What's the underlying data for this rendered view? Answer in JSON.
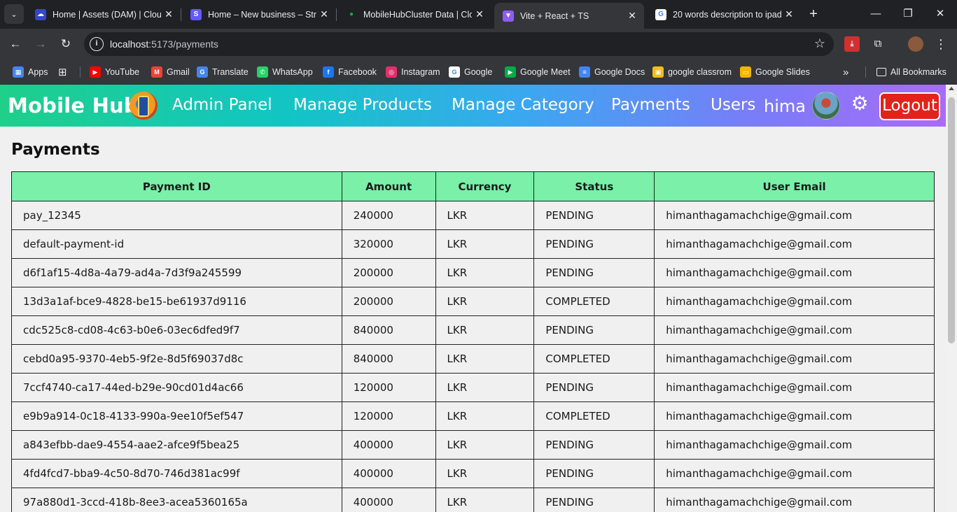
{
  "browser": {
    "tabs": [
      {
        "title": "Home | Assets (DAM) | Cloudinary",
        "favicon_color": "#3448c5",
        "favicon_glyph": "☁"
      },
      {
        "title": "Home – New business – Stripe",
        "favicon_color": "#635bff",
        "favicon_glyph": "S"
      },
      {
        "title": "MobileHubCluster Data | Cloud",
        "favicon_color": "#202124",
        "favicon_glyph": "●"
      },
      {
        "title": "Vite + React + TS",
        "favicon_color": "#8f5cf6",
        "favicon_glyph": "▼"
      },
      {
        "title": "20 words description to ipad",
        "favicon_color": "#ffffff",
        "favicon_glyph": "G"
      }
    ],
    "active_tab_index": 3,
    "url_host": "localhost",
    "url_path": ":5173/payments",
    "bookmarks": [
      {
        "label": "Apps",
        "icon": "apps-grid-icon",
        "color": "#4285f4"
      },
      {
        "label": "YouTube",
        "icon": "youtube-icon",
        "color": "#ff0000"
      },
      {
        "label": "Gmail",
        "icon": "gmail-icon",
        "color": "#ea4335"
      },
      {
        "label": "Translate",
        "icon": "translate-icon",
        "color": "#4285f4"
      },
      {
        "label": "WhatsApp",
        "icon": "whatsapp-icon",
        "color": "#25d366"
      },
      {
        "label": "Facebook",
        "icon": "facebook-icon",
        "color": "#1877f2"
      },
      {
        "label": "Instagram",
        "icon": "instagram-icon",
        "color": "#e1306c"
      },
      {
        "label": "Google",
        "icon": "google-icon",
        "color": "#ffffff"
      },
      {
        "label": "Google Meet",
        "icon": "google-meet-icon",
        "color": "#00ac47"
      },
      {
        "label": "Google Docs",
        "icon": "google-docs-icon",
        "color": "#4285f4"
      },
      {
        "label": "google classrom",
        "icon": "google-classroom-icon",
        "color": "#f6bb18"
      },
      {
        "label": "Google Slides",
        "icon": "google-slides-icon",
        "color": "#f4b400"
      }
    ],
    "all_bookmarks_label": "All Bookmarks"
  },
  "navbar": {
    "brand": "Mobile Hub",
    "links": [
      "Admin Panel",
      "Manage Products",
      "Manage Category",
      "Payments",
      "Users"
    ],
    "username": "hima",
    "logout_label": "Logout",
    "accent_gradient": [
      "#1fcf8a",
      "#a86cf6"
    ],
    "logout_color": "#e2231a"
  },
  "main": {
    "title": "Payments",
    "columns": [
      "Payment ID",
      "Amount",
      "Currency",
      "Status",
      "User Email"
    ],
    "header_color": "#7af0a8",
    "rows": [
      [
        "pay_12345",
        "240000",
        "LKR",
        "PENDING",
        "himanthagamachchige@gmail.com"
      ],
      [
        "default-payment-id",
        "320000",
        "LKR",
        "PENDING",
        "himanthagamachchige@gmail.com"
      ],
      [
        "d6f1af15-4d8a-4a79-ad4a-7d3f9a245599",
        "200000",
        "LKR",
        "PENDING",
        "himanthagamachchige@gmail.com"
      ],
      [
        "13d3a1af-bce9-4828-be15-be61937d9116",
        "200000",
        "LKR",
        "COMPLETED",
        "himanthagamachchige@gmail.com"
      ],
      [
        "cdc525c8-cd08-4c63-b0e6-03ec6dfed9f7",
        "840000",
        "LKR",
        "PENDING",
        "himanthagamachchige@gmail.com"
      ],
      [
        "cebd0a95-9370-4eb5-9f2e-8d5f69037d8c",
        "840000",
        "LKR",
        "COMPLETED",
        "himanthagamachchige@gmail.com"
      ],
      [
        "7ccf4740-ca17-44ed-b29e-90cd01d4ac66",
        "120000",
        "LKR",
        "PENDING",
        "himanthagamachchige@gmail.com"
      ],
      [
        "e9b9a914-0c18-4133-990a-9ee10f5ef547",
        "120000",
        "LKR",
        "COMPLETED",
        "himanthagamachchige@gmail.com"
      ],
      [
        "a843efbb-dae9-4554-aae2-afce9f5bea25",
        "400000",
        "LKR",
        "PENDING",
        "himanthagamachchige@gmail.com"
      ],
      [
        "4fd4fcd7-bba9-4c50-8d70-746d381ac99f",
        "400000",
        "LKR",
        "PENDING",
        "himanthagamachchige@gmail.com"
      ],
      [
        "97a880d1-3ccd-418b-8ee3-acea5360165a",
        "400000",
        "LKR",
        "PENDING",
        "himanthagamachchige@gmail.com"
      ]
    ]
  }
}
